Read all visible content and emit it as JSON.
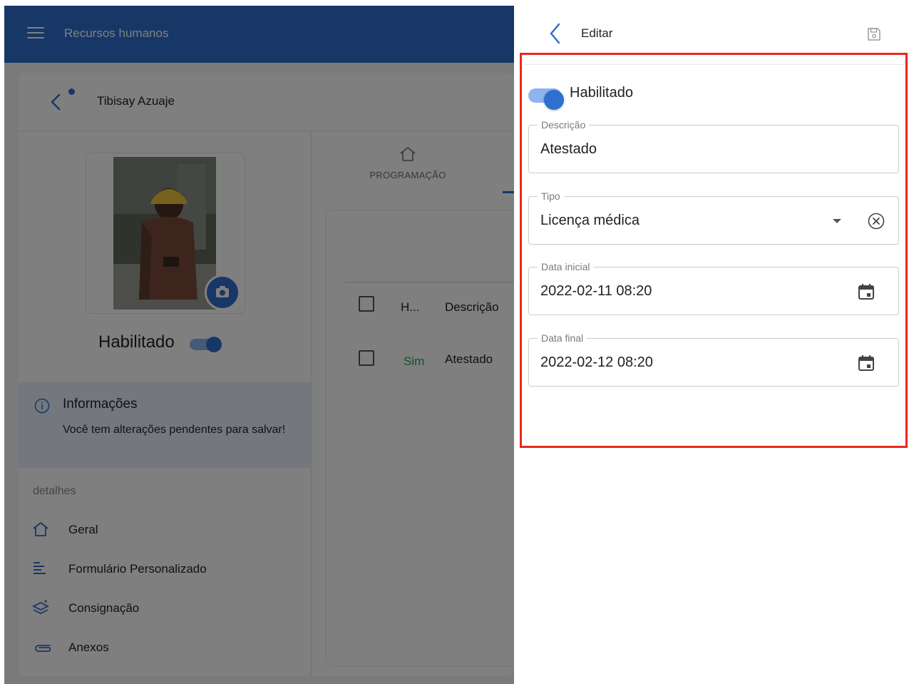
{
  "app": {
    "title": "Recursos humanos"
  },
  "person": {
    "name": "Tibisay Azuaje",
    "status_label": "Habilitado"
  },
  "info": {
    "title": "Informações",
    "message": "Você tem alterações pendentes para salvar!"
  },
  "details": {
    "section_label": "detalhes",
    "items": [
      {
        "label": "Geral",
        "icon": "home-icon"
      },
      {
        "label": "Formulário Personalizado",
        "icon": "form-list-icon"
      },
      {
        "label": "Consignação",
        "icon": "layers-icon"
      },
      {
        "label": "Anexos",
        "icon": "paperclip-icon"
      }
    ]
  },
  "tabs": {
    "programacao": "PROGRAMAÇÃO"
  },
  "grid": {
    "header_h": "H...",
    "header_descricao": "Descrição",
    "rows": [
      {
        "habilitado": "Sim",
        "descricao": "Atestado"
      }
    ]
  },
  "edit": {
    "title": "Editar",
    "enabled_label": "Habilitado",
    "enabled": true,
    "descricao": {
      "label": "Descrição",
      "value": "Atestado"
    },
    "tipo": {
      "label": "Tipo",
      "value": "Licença médica"
    },
    "data_inicial": {
      "label": "Data inicial",
      "value": "2022-02-11 08:20"
    },
    "data_final": {
      "label": "Data final",
      "value": "2022-02-12 08:20"
    }
  },
  "colors": {
    "brand": "#2f6fce",
    "highlight_frame": "#e8281c",
    "success": "#1fa84a"
  }
}
